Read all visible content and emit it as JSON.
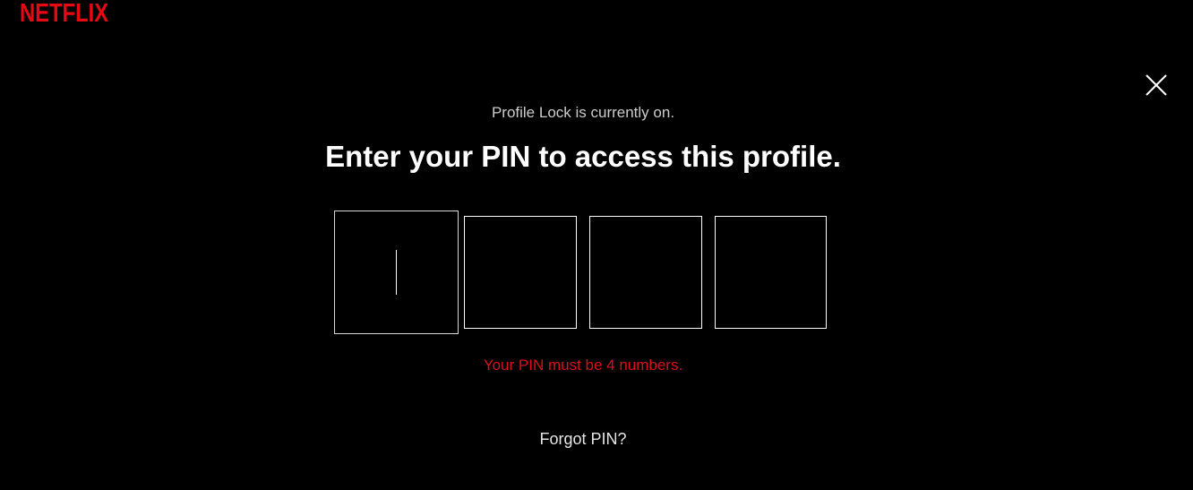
{
  "brand": {
    "logo_text": "NETFLIX",
    "color": "#e50914"
  },
  "dialog": {
    "close_icon": "close-icon",
    "subtitle": "Profile Lock is currently on.",
    "headline": "Enter your PIN to access this profile.",
    "pin_inputs": [
      "",
      "",
      "",
      ""
    ],
    "focused_index": 0,
    "error_message": "Your PIN must be 4 numbers.",
    "error_color": "#d8101f",
    "forgot_link": "Forgot PIN?"
  }
}
